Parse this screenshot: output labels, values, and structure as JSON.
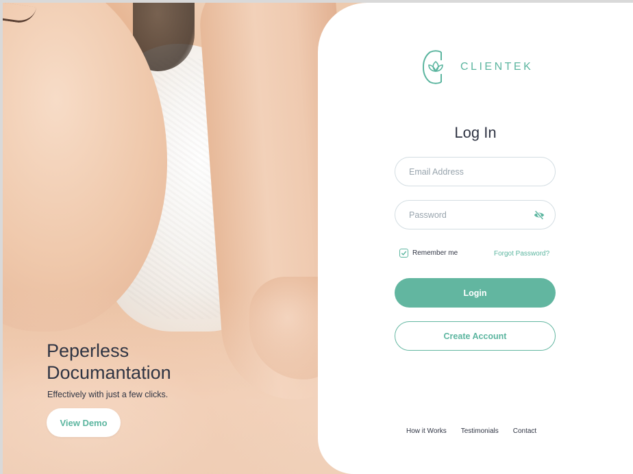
{
  "brand": {
    "name": "CLIENTEK",
    "logo_icon": "lotus-logo-icon",
    "accent_color": "#5bb59f"
  },
  "hero": {
    "title": "Peperless Documantation",
    "subtitle": "Effectively with just a few clicks.",
    "demo_button_label": "View Demo"
  },
  "login": {
    "title": "Log In",
    "email_placeholder": "Email Address",
    "email_value": "",
    "password_placeholder": "Password",
    "password_value": "",
    "password_toggle_icon": "eye-slash-icon",
    "remember_label": "Remember me",
    "remember_checked": true,
    "forgot_label": "Forgot Password?",
    "login_button_label": "Login",
    "create_account_label": "Create Account"
  },
  "footer": {
    "links": [
      "How it Works",
      "Testimonials",
      "Contact"
    ]
  }
}
